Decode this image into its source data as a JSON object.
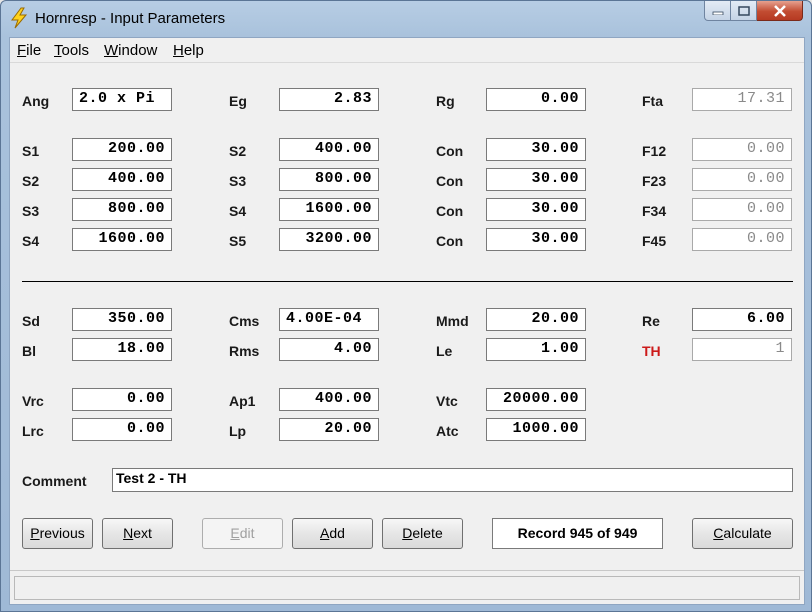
{
  "window": {
    "title": "Hornresp - Input Parameters"
  },
  "menu": [
    {
      "label": "File",
      "accel": "F",
      "rest": "ile"
    },
    {
      "label": "Tools",
      "accel": "T",
      "rest": "ools"
    },
    {
      "label": "Window",
      "accel": "W",
      "rest": "indow"
    },
    {
      "label": "Help",
      "accel": "H",
      "rest": "elp"
    }
  ],
  "params": {
    "ang": {
      "label": "Ang",
      "value": "2.0 x Pi"
    },
    "eg": {
      "label": "Eg",
      "value": "2.83"
    },
    "rg": {
      "label": "Rg",
      "value": "0.00"
    },
    "fta": {
      "label": "Fta",
      "value": "17.31"
    },
    "s1": {
      "label": "S1",
      "value": "200.00"
    },
    "s2a": {
      "label": "S2",
      "value": "400.00"
    },
    "con1": {
      "label": "Con",
      "value": "30.00"
    },
    "f12": {
      "label": "F12",
      "value": "0.00"
    },
    "s2": {
      "label": "S2",
      "value": "400.00"
    },
    "s3a": {
      "label": "S3",
      "value": "800.00"
    },
    "con2": {
      "label": "Con",
      "value": "30.00"
    },
    "f23": {
      "label": "F23",
      "value": "0.00"
    },
    "s3": {
      "label": "S3",
      "value": "800.00"
    },
    "s4a": {
      "label": "S4",
      "value": "1600.00"
    },
    "con3": {
      "label": "Con",
      "value": "30.00"
    },
    "f34": {
      "label": "F34",
      "value": "0.00"
    },
    "s4": {
      "label": "S4",
      "value": "1600.00"
    },
    "s5": {
      "label": "S5",
      "value": "3200.00"
    },
    "con4": {
      "label": "Con",
      "value": "30.00"
    },
    "f45": {
      "label": "F45",
      "value": "0.00"
    },
    "sd": {
      "label": "Sd",
      "value": "350.00"
    },
    "cms": {
      "label": "Cms",
      "value": "4.00E-04"
    },
    "mmd": {
      "label": "Mmd",
      "value": "20.00"
    },
    "re": {
      "label": "Re",
      "value": "6.00"
    },
    "bl": {
      "label": "Bl",
      "value": "18.00"
    },
    "rms": {
      "label": "Rms",
      "value": "4.00"
    },
    "le": {
      "label": "Le",
      "value": "1.00"
    },
    "th": {
      "label": "TH",
      "value": "1"
    },
    "vrc": {
      "label": "Vrc",
      "value": "0.00"
    },
    "ap1": {
      "label": "Ap1",
      "value": "400.00"
    },
    "vtc": {
      "label": "Vtc",
      "value": "20000.00"
    },
    "lrc": {
      "label": "Lrc",
      "value": "0.00"
    },
    "lp": {
      "label": "Lp",
      "value": "20.00"
    },
    "atc": {
      "label": "Atc",
      "value": "1000.00"
    }
  },
  "comment": {
    "label": "Comment",
    "value": "Test 2 - TH"
  },
  "buttons": {
    "previous": {
      "accel": "P",
      "rest": "revious"
    },
    "next": {
      "accel": "N",
      "rest": "ext"
    },
    "edit": {
      "accel": "E",
      "rest": "dit"
    },
    "add": {
      "accel": "A",
      "rest": "dd"
    },
    "delete": {
      "accel": "D",
      "rest": "elete"
    },
    "calculate": {
      "accel": "C",
      "rest": "alculate"
    }
  },
  "record": "Record 945 of 949",
  "colors": {
    "th_label": "#cc1a1a",
    "disabled": "#a0a0a0"
  }
}
